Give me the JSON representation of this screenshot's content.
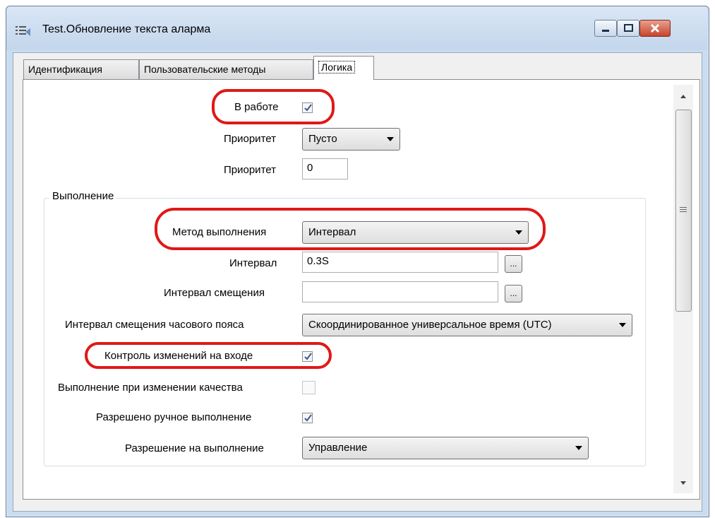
{
  "window": {
    "title": "Test.Обновление текста аларма",
    "icon": "app-list-icon",
    "buttons": [
      "minimize-icon",
      "maximize-icon",
      "close-icon"
    ]
  },
  "tabs": [
    {
      "label": "Идентификация",
      "selected": false
    },
    {
      "label": "Пользовательские методы",
      "selected": false
    },
    {
      "label": "Логика",
      "selected": true
    }
  ],
  "fields": {
    "in_work": {
      "label": "В работе",
      "checked": true
    },
    "priority_combo": {
      "label": "Приоритет",
      "value": "Пусто"
    },
    "priority_value": {
      "label": "Приоритет",
      "value": "0"
    }
  },
  "execution": {
    "group_title": "Выполнение",
    "method": {
      "label": "Метод выполнения",
      "value": "Интервал"
    },
    "interval": {
      "label": "Интервал",
      "value": "0.3S",
      "button": "..."
    },
    "offset_interval": {
      "label": "Интервал смещения",
      "value": "",
      "button": "..."
    },
    "timezone_offset": {
      "label": "Интервал смещения часового пояса",
      "value": "Скоординированное универсальное время (UTC)"
    },
    "input_change_control": {
      "label": "Контроль изменений на входе",
      "checked": true
    },
    "quality_change_exec": {
      "label": "Выполнение при изменении качества",
      "checked": false
    },
    "manual_exec_allowed": {
      "label": "Разрешено ручное выполнение",
      "checked": true
    },
    "exec_permission": {
      "label": "Разрешение на выполнение",
      "value": "Управление"
    }
  },
  "colors": {
    "highlight": "#e01818",
    "check": "#3b5998"
  }
}
